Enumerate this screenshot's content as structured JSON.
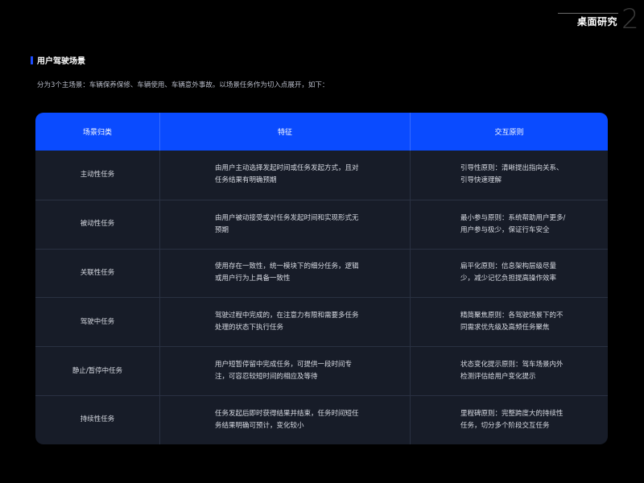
{
  "header": {
    "title": "桌面研究",
    "number": "2"
  },
  "section": {
    "title": "用户驾驶场景",
    "intro": "分为3个主场景：车辆保养保修、车辆使用、车辆意外事故。以场景任务作为切入点展开，如下："
  },
  "table": {
    "columns": [
      "场景归类",
      "特征",
      "交互原则"
    ],
    "rows": [
      {
        "category": "主动性任务",
        "feature": "由用户主动选择发起时间或任务发起方式，且对任务结果有明确预期",
        "principle": "引导性原则：清晰提出指向关系、引导快速理解"
      },
      {
        "category": "被动性任务",
        "feature": "由用户被动接受或对任务发起时间和实现形式无预期",
        "principle": "最小参与原则：系统帮助用户更多/用户参与极少，保证行车安全"
      },
      {
        "category": "关联性任务",
        "feature": "使用存在一致性，统一模块下的细分任务，逻辑或用户行为上具备一致性",
        "principle": "扁平化原则：信息架构层级尽量少，减少记忆负担提高操作效率"
      },
      {
        "category": "驾驶中任务",
        "feature": "驾驶过程中完成的，在注意力有限和需要多任务处理的状态下执行任务",
        "principle": "精简聚焦原则：各驾驶场景下的不同需求优先级及高频任务聚焦"
      },
      {
        "category": "静止/暂停中任务",
        "feature": "用户短暂停留中完成任务，可提供一段时间专注，可容忍较短时间的相应及等待",
        "principle": "状态变化提示原则：驾车场景内外检测评估给用户变化提示"
      },
      {
        "category": "持续性任务",
        "feature": "任务发起后即时获得结果并结束，任务时间短任务结果明确可预计，变化较小",
        "principle": "里程碑原则：完整跨度大的持续性任务，切分多个阶段交互任务"
      }
    ]
  },
  "colors": {
    "accent": "#0a4bff",
    "table_bg": "#171c28",
    "background": "#000000"
  }
}
